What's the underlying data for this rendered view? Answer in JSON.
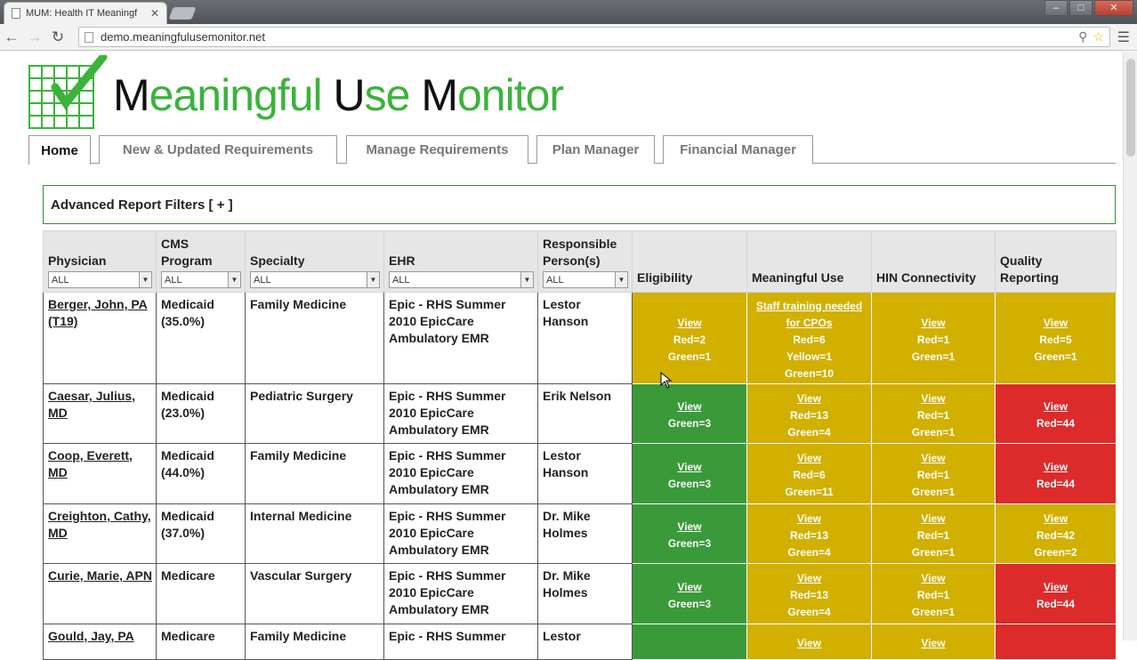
{
  "browser": {
    "tab_title": "MUM: Health IT Meaningf",
    "tab_close": "✕",
    "url": "demo.meaningfulusemonitor.net"
  },
  "logo": {
    "part1": "M",
    "part2": "eaningful ",
    "part3": "U",
    "part4": "se ",
    "part5": "M",
    "part6": "onitor"
  },
  "nav": [
    "Home",
    "New & Updated Requirements",
    "Manage Requirements",
    "Plan Manager",
    "Financial Manager"
  ],
  "filters": {
    "label": "Advanced Report Filters [ + ]"
  },
  "table": {
    "headers": {
      "physician": [
        "Physician"
      ],
      "cms": [
        "CMS",
        "Program"
      ],
      "specialty": [
        "Specialty"
      ],
      "ehr": [
        "EHR"
      ],
      "responsible": [
        "Responsible",
        "Person(s)"
      ],
      "eligibility": [
        "Eligibility"
      ],
      "mu": [
        "Meaningful Use"
      ],
      "hin": [
        "HIN Connectivity"
      ],
      "quality": [
        "Quality",
        "Reporting"
      ]
    },
    "filter_value": "ALL",
    "rows": [
      {
        "physician": "Berger, John, PA (T19)",
        "cms": "Medicaid (35.0%)",
        "specialty": "Family Medicine",
        "ehr": "Epic - RHS Summer 2010 EpicCare Ambulatory EMR",
        "responsible": "Lestor Hanson",
        "eligibility": {
          "color": "yellow",
          "lines": [
            "View",
            "Red=2",
            "Green=1"
          ]
        },
        "mu": {
          "color": "yellow",
          "lines": [
            "Staff training needed for CPOs",
            "Red=6",
            "Yellow=1",
            "Green=10"
          ]
        },
        "hin": {
          "color": "yellow",
          "lines": [
            "View",
            "Red=1",
            "Green=1"
          ]
        },
        "quality": {
          "color": "yellow",
          "lines": [
            "View",
            "Red=5",
            "Green=1"
          ]
        }
      },
      {
        "physician": "Caesar, Julius, MD",
        "cms": "Medicaid (23.0%)",
        "specialty": "Pediatric Surgery",
        "ehr": "Epic - RHS Summer 2010 EpicCare Ambulatory EMR",
        "responsible": "Erik Nelson",
        "eligibility": {
          "color": "green",
          "lines": [
            "View",
            "Green=3"
          ]
        },
        "mu": {
          "color": "yellow",
          "lines": [
            "View",
            "Red=13",
            "Green=4"
          ]
        },
        "hin": {
          "color": "yellow",
          "lines": [
            "View",
            "Red=1",
            "Green=1"
          ]
        },
        "quality": {
          "color": "red",
          "lines": [
            "View",
            "Red=44"
          ]
        }
      },
      {
        "physician": "Coop, Everett, MD",
        "cms": "Medicaid (44.0%)",
        "specialty": "Family Medicine",
        "ehr": "Epic - RHS Summer 2010 EpicCare Ambulatory EMR",
        "responsible": "Lestor Hanson",
        "eligibility": {
          "color": "green",
          "lines": [
            "View",
            "Green=3"
          ]
        },
        "mu": {
          "color": "yellow",
          "lines": [
            "View",
            "Red=6",
            "Green=11"
          ]
        },
        "hin": {
          "color": "yellow",
          "lines": [
            "View",
            "Red=1",
            "Green=1"
          ]
        },
        "quality": {
          "color": "red",
          "lines": [
            "View",
            "Red=44"
          ]
        }
      },
      {
        "physician": "Creighton, Cathy, MD",
        "cms": "Medicaid (37.0%)",
        "specialty": "Internal Medicine",
        "ehr": "Epic - RHS Summer 2010 EpicCare Ambulatory EMR",
        "responsible": "Dr. Mike Holmes",
        "eligibility": {
          "color": "green",
          "lines": [
            "View",
            "Green=3"
          ]
        },
        "mu": {
          "color": "yellow",
          "lines": [
            "View",
            "Red=13",
            "Green=4"
          ]
        },
        "hin": {
          "color": "yellow",
          "lines": [
            "View",
            "Red=1",
            "Green=1"
          ]
        },
        "quality": {
          "color": "yellow",
          "lines": [
            "View",
            "Red=42",
            "Green=2"
          ]
        }
      },
      {
        "physician": "Curie, Marie, APN",
        "cms": "Medicare",
        "specialty": "Vascular Surgery",
        "ehr": "Epic - RHS Summer 2010 EpicCare Ambulatory EMR",
        "responsible": "Dr. Mike Holmes",
        "eligibility": {
          "color": "green",
          "lines": [
            "View",
            "Green=3"
          ]
        },
        "mu": {
          "color": "yellow",
          "lines": [
            "View",
            "Red=13",
            "Green=4"
          ]
        },
        "hin": {
          "color": "yellow",
          "lines": [
            "View",
            "Red=1",
            "Green=1"
          ]
        },
        "quality": {
          "color": "red",
          "lines": [
            "View",
            "Red=44"
          ]
        }
      },
      {
        "physician": "Gould, Jay, PA",
        "cms": "Medicare",
        "specialty": "Family Medicine",
        "ehr": "Epic - RHS Summer",
        "responsible": "Lestor",
        "eligibility": {
          "color": "green",
          "lines": [
            ""
          ]
        },
        "mu": {
          "color": "yellow",
          "lines": [
            "View"
          ]
        },
        "hin": {
          "color": "yellow",
          "lines": [
            "View"
          ]
        },
        "quality": {
          "color": "red",
          "lines": [
            ""
          ]
        }
      }
    ]
  },
  "colors": {
    "yellow": "#d1b000",
    "green": "#3a9a3a",
    "red": "#dd2a2a",
    "logo_green": "#3bb33b"
  }
}
